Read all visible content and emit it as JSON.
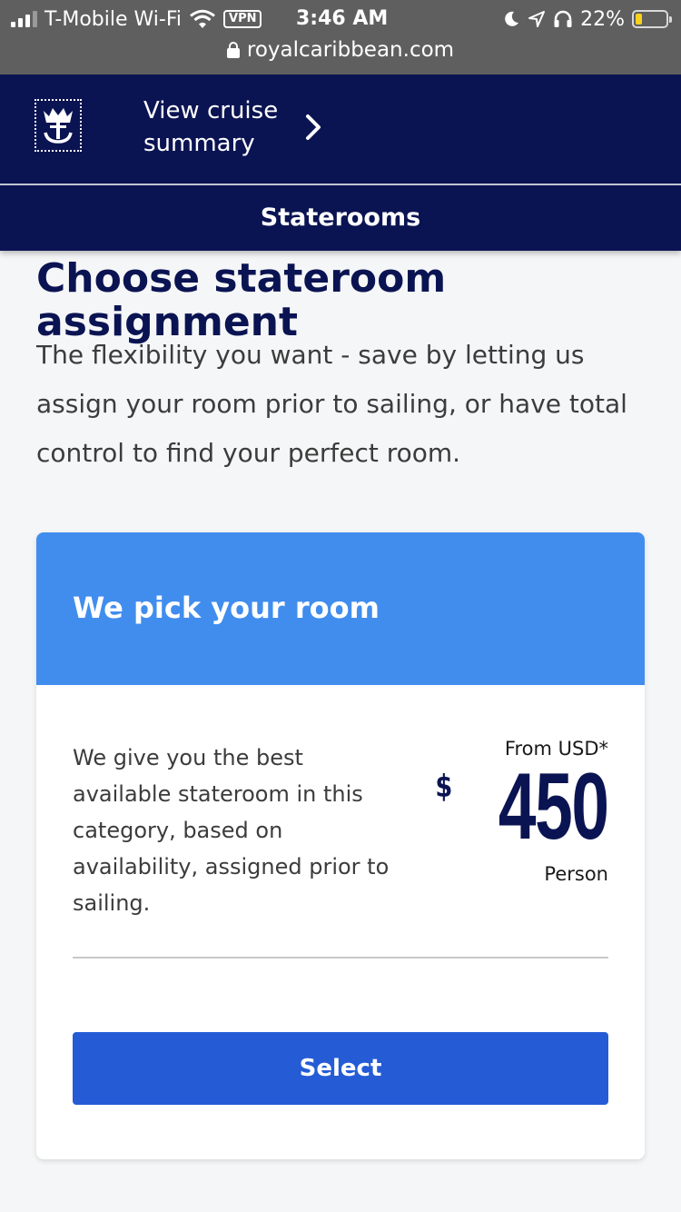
{
  "status_bar": {
    "carrier": "T-Mobile Wi-Fi",
    "vpn": "VPN",
    "time": "3:46 AM",
    "battery_percent": "22%",
    "battery_level": 0.22,
    "battery_color": "#f6d21c"
  },
  "browser": {
    "url": "royalcaribbean.com"
  },
  "header": {
    "summary_link": "View cruise summary",
    "step": "Staterooms"
  },
  "main": {
    "title": "Choose stateroom assignment",
    "intro": "The flexibility you want - save by letting us assign your room prior to sailing, or have total control to find your perfect room."
  },
  "option_card": {
    "title": "We pick your room",
    "description": "We give you the best available stateroom in this category, based on availability, assigned prior to sailing.",
    "price_label": "From USD*",
    "currency_symbol": "$",
    "price": "450",
    "price_unit": "Person",
    "button": "Select"
  },
  "colors": {
    "brand_navy": "#0b1452",
    "card_header_blue": "#418dee",
    "button_blue": "#255cd6"
  },
  "icons": [
    "signal-icon",
    "wifi-icon",
    "moon-icon",
    "location-icon",
    "headphones-icon",
    "battery-icon",
    "lock-icon",
    "crown-anchor-logo",
    "chevron-right-icon"
  ]
}
